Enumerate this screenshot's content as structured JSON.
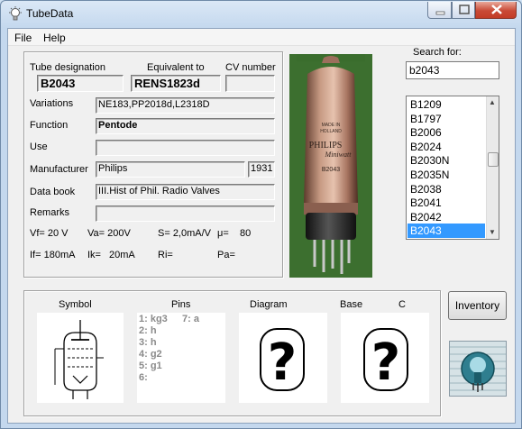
{
  "window": {
    "title": "TubeData"
  },
  "menu": {
    "file": "File",
    "help": "Help"
  },
  "labels": {
    "tube_designation": "Tube designation",
    "equivalent_to": "Equivalent to",
    "cv_number": "CV number",
    "variations": "Variations",
    "function": "Function",
    "use": "Use",
    "manufacturer": "Manufacturer",
    "data_book": "Data book",
    "remarks": "Remarks",
    "search_for": "Search for:"
  },
  "values": {
    "tube_designation": "B2043",
    "equivalent_to": "RENS1823d",
    "cv_number": "",
    "variations": "NE183,PP2018d,L2318D",
    "function": "Pentode",
    "use": "",
    "manufacturer": "Philips",
    "year": "1931",
    "data_book": "III.Hist of Phil. Radio Valves",
    "remarks": ""
  },
  "specs": {
    "vf": "Vf= 20 V",
    "va": "Va=  200V",
    "s": "S= 2,0mA/V",
    "mu": "μ=",
    "mu_value": "80",
    "if": "If= 180mA",
    "ik": "Ik=",
    "ik_value": "20mA",
    "ri": "Ri=",
    "pa": "Pa="
  },
  "photo": {
    "line1": "MADE IN",
    "line2": "HOLLAND",
    "brand": "PHILIPS",
    "sub": "Miniwatt",
    "type": "B2043"
  },
  "search": {
    "value": "b2043"
  },
  "list": {
    "items": [
      "B1209",
      "B1797",
      "B2006",
      "B2024",
      "B2030N",
      "B2035N",
      "B2038",
      "B2041",
      "B2042",
      "B2043"
    ],
    "selected": "B2043"
  },
  "bottom": {
    "symbol": "Symbol",
    "pins": "Pins",
    "diagram": "Diagram",
    "base": "Base",
    "base_code": "C",
    "pins_list": [
      "1: kg3",
      "2: h",
      "3: h",
      "4: g2",
      "5: g1",
      "6:"
    ],
    "pin7": "7: a",
    "unknown_glyph": "?"
  },
  "buttons": {
    "inventory": "Inventory"
  },
  "colors": {
    "selection": "#3399ff",
    "photo_bg": "#3c6f2f",
    "close_button": "#c94a36"
  }
}
